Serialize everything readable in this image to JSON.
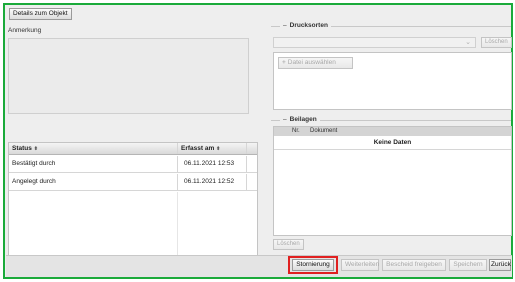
{
  "top_button": {
    "label": "Details zum Objekt"
  },
  "anmerkung": {
    "label": "Anmerkung"
  },
  "status_table": {
    "headers": [
      {
        "label": "Status",
        "sort": "⬍"
      },
      {
        "label": "Erfasst am",
        "sort": "⬍"
      }
    ],
    "rows": [
      {
        "status": "Bestätigt durch",
        "erfasst_am": "06.11.2021 12:53"
      },
      {
        "status": "Angelegt durch",
        "erfasst_am": "06.11.2021 12:52"
      }
    ]
  },
  "drucksorten": {
    "title": "Drucksorten",
    "select_value": "",
    "remove_label": "Löschen",
    "add_label": "Datei auswählen",
    "add_icon": "plus-icon"
  },
  "beilagen": {
    "title": "Beilagen",
    "col_nr": "Nr.",
    "col_dokument": "Dokument",
    "empty_text": "Keine Daten",
    "remove_label": "Löschen"
  },
  "actions": {
    "stornierung": "Stornierung",
    "weiterleiten": "Weiterleiten",
    "bescheid": "Bescheid freigeben",
    "speichern": "Speichern",
    "zurueck": "Zurück"
  },
  "colors": {
    "frame_border": "#1aaa3a",
    "highlight": "#e02020"
  }
}
